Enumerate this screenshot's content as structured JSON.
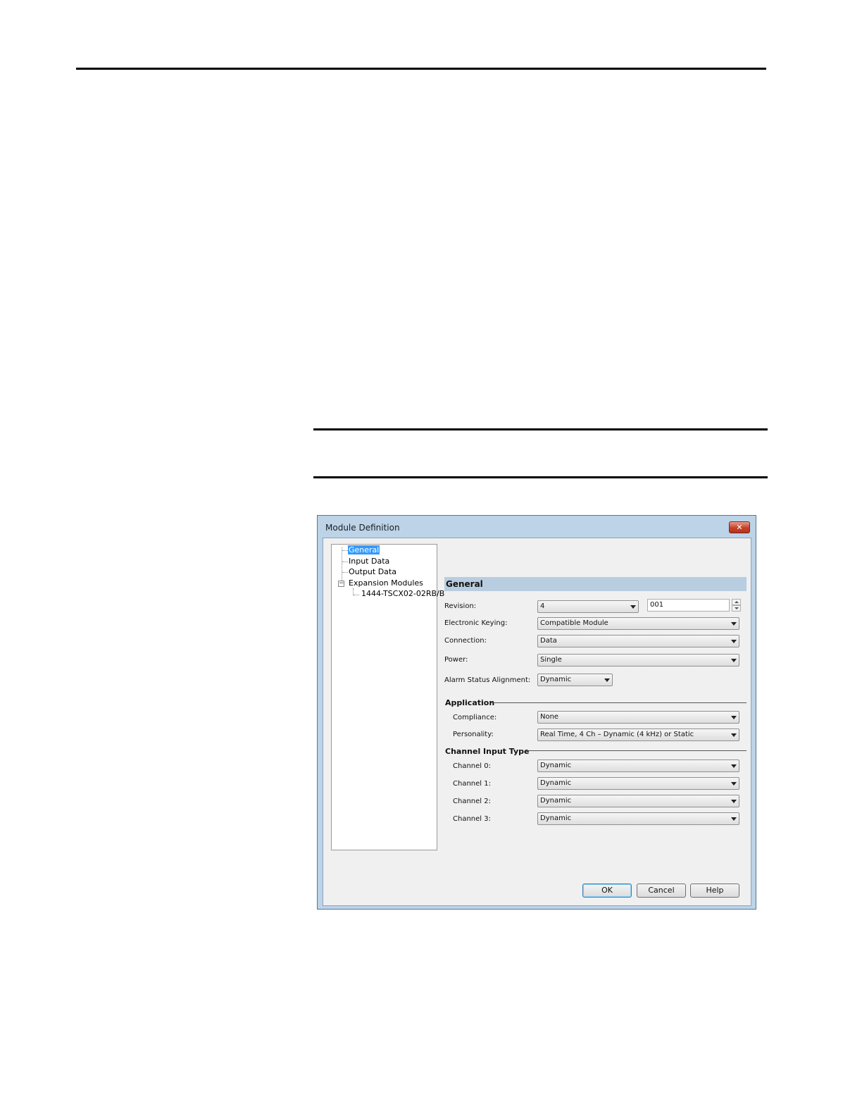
{
  "dialog": {
    "title": "Module Definition",
    "close_label": "✕"
  },
  "tree": {
    "items": [
      {
        "label": "General",
        "selected": true
      },
      {
        "label": "Input Data"
      },
      {
        "label": "Output Data"
      },
      {
        "label": "Expansion Modules",
        "expanded": true
      },
      {
        "label": "1444-TSCX02-02RB/B"
      }
    ],
    "expander_glyph": "−"
  },
  "general": {
    "header": "General",
    "revision": {
      "label": "Revision:",
      "major": "4",
      "minor": "001"
    },
    "electronic_keying": {
      "label": "Electronic Keying:",
      "value": "Compatible Module"
    },
    "connection": {
      "label": "Connection:",
      "value": "Data"
    },
    "power": {
      "label": "Power:",
      "value": "Single"
    },
    "alarm_status_alignment": {
      "label": "Alarm Status Alignment:",
      "value": "Dynamic"
    }
  },
  "application": {
    "title": "Application",
    "compliance": {
      "label": "Compliance:",
      "value": "None"
    },
    "personality": {
      "label": "Personality:",
      "value": "Real Time, 4 Ch – Dynamic (4 kHz) or Static"
    }
  },
  "channel_input_type": {
    "title": "Channel Input Type",
    "channels": [
      {
        "label": "Channel 0:",
        "value": "Dynamic"
      },
      {
        "label": "Channel 1:",
        "value": "Dynamic"
      },
      {
        "label": "Channel 2:",
        "value": "Dynamic"
      },
      {
        "label": "Channel 3:",
        "value": "Dynamic"
      }
    ]
  },
  "buttons": {
    "ok": "OK",
    "cancel": "Cancel",
    "help": "Help"
  }
}
